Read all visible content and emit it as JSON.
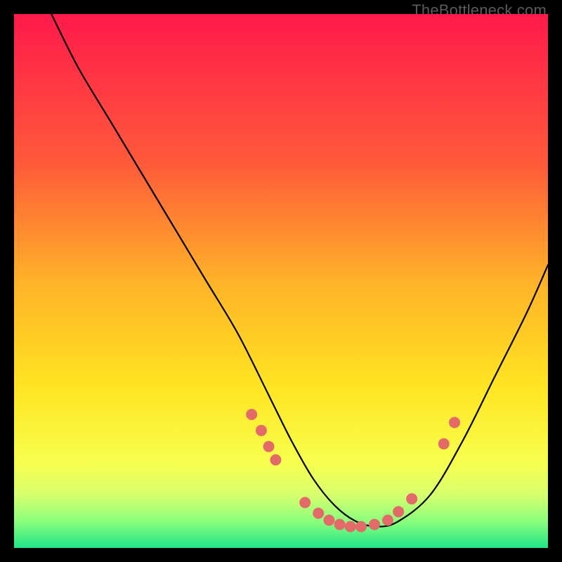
{
  "watermark": "TheBottleneck.com",
  "chart_data": {
    "type": "line",
    "title": "",
    "xlabel": "",
    "ylabel": "",
    "xlim": [
      0,
      100
    ],
    "ylim": [
      0,
      100
    ],
    "grid": false,
    "legend": false,
    "gradient_stops": [
      {
        "pct": 0,
        "color": "#ff1a4b"
      },
      {
        "pct": 28,
        "color": "#ff5a3a"
      },
      {
        "pct": 50,
        "color": "#ffb228"
      },
      {
        "pct": 70,
        "color": "#ffe522"
      },
      {
        "pct": 84,
        "color": "#f7ff4e"
      },
      {
        "pct": 90,
        "color": "#d8ff6e"
      },
      {
        "pct": 95,
        "color": "#8bff7c"
      },
      {
        "pct": 100,
        "color": "#20e588"
      }
    ],
    "series": [
      {
        "name": "bottleneck-curve",
        "x": [
          7,
          12,
          18,
          24,
          30,
          36,
          42,
          48,
          52,
          56,
          60,
          64,
          68,
          72,
          78,
          84,
          90,
          96,
          100
        ],
        "y": [
          100,
          90,
          80,
          70,
          60,
          50,
          40,
          28,
          20,
          13,
          8,
          5,
          4,
          5,
          10,
          20,
          32,
          44,
          53
        ]
      }
    ],
    "markers": {
      "name": "highlight-points",
      "color": "#e46a6a",
      "radius_px": 8,
      "points": [
        {
          "x": 44.5,
          "y": 25
        },
        {
          "x": 46.3,
          "y": 22
        },
        {
          "x": 47.7,
          "y": 19
        },
        {
          "x": 49.0,
          "y": 16.5
        },
        {
          "x": 54.5,
          "y": 8.5
        },
        {
          "x": 57.0,
          "y": 6.5
        },
        {
          "x": 59.0,
          "y": 5.2
        },
        {
          "x": 61.0,
          "y": 4.4
        },
        {
          "x": 63.0,
          "y": 4.0
        },
        {
          "x": 65.0,
          "y": 4.0
        },
        {
          "x": 67.5,
          "y": 4.4
        },
        {
          "x": 70.0,
          "y": 5.2
        },
        {
          "x": 72.0,
          "y": 6.8
        },
        {
          "x": 74.5,
          "y": 9.2
        },
        {
          "x": 80.5,
          "y": 19.5
        },
        {
          "x": 82.5,
          "y": 23.5
        }
      ]
    }
  }
}
